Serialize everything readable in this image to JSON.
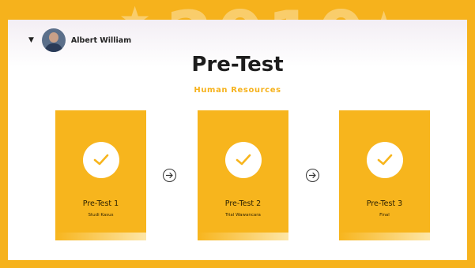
{
  "watermark": {
    "text": "2010"
  },
  "user": {
    "name": "Albert William"
  },
  "header": {
    "title": "Pre-Test",
    "subtitle": "Human Resources"
  },
  "steps": [
    {
      "title": "Pre-Test 1",
      "subtitle": "Studi Kasus"
    },
    {
      "title": "Pre-Test 2",
      "subtitle": "Trial Wawancara"
    },
    {
      "title": "Pre-Test 3",
      "subtitle": "Final"
    }
  ],
  "colors": {
    "accent": "#f6b21c",
    "card": "#f7b51d",
    "panel": "#ffffff"
  },
  "icons": {
    "caret": "caret-down-icon",
    "check": "check-icon",
    "arrow": "arrow-right-circle-icon"
  }
}
